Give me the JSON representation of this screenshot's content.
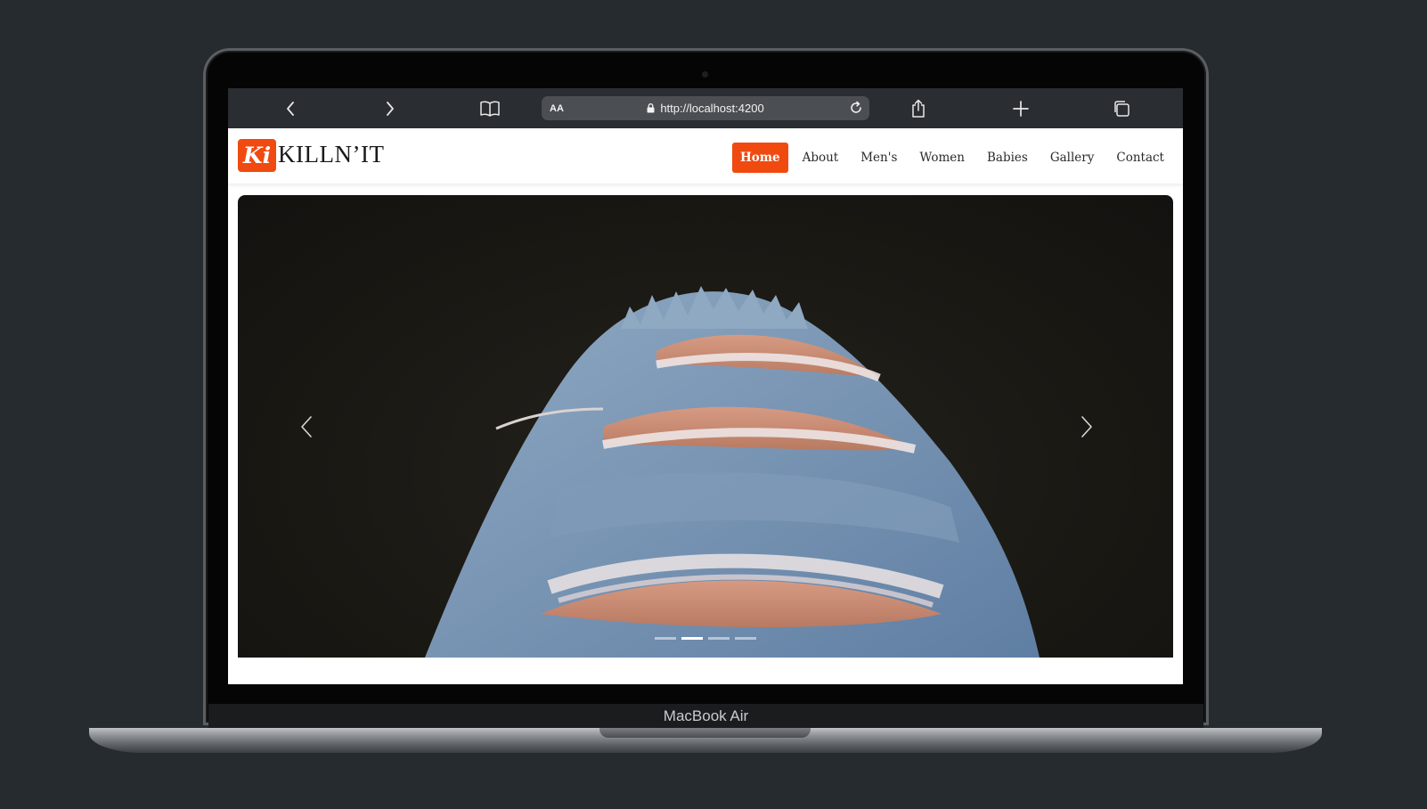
{
  "device": {
    "label": "MacBook Air"
  },
  "browser": {
    "url": "http://localhost:4200",
    "reader_label": "AA",
    "icons": [
      "back-icon",
      "forward-icon",
      "bookmarks-icon",
      "lock-icon",
      "reload-icon",
      "share-icon",
      "new-tab-icon",
      "tabs-icon"
    ]
  },
  "site": {
    "logo_mark": "Ki",
    "logo_text": "KILLN’IT",
    "accent_color": "#f04a10",
    "nav": [
      {
        "label": "Home",
        "active": true
      },
      {
        "label": "About"
      },
      {
        "label": "Men's"
      },
      {
        "label": "Women"
      },
      {
        "label": "Babies"
      },
      {
        "label": "Gallery"
      },
      {
        "label": "Contact"
      }
    ]
  },
  "carousel": {
    "image_subject": "close-up of ripped denim jeans at the knee",
    "slide_count": 4,
    "active_slide": 2,
    "prev_icon": "chevron-left-icon",
    "next_icon": "chevron-right-icon"
  }
}
